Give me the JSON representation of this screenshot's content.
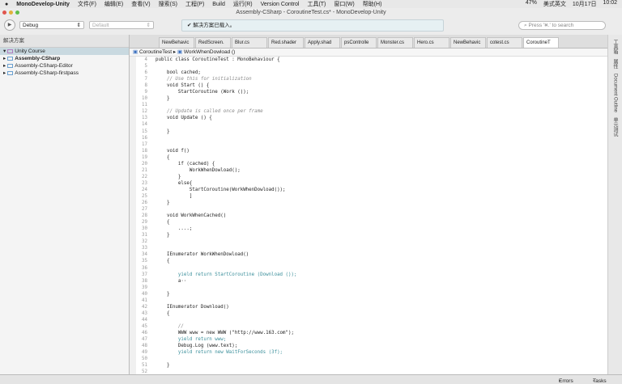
{
  "menubar": {
    "app": "MonoDevelop-Unity",
    "items": [
      "文件(F)",
      "编辑(E)",
      "查看(V)",
      "搜索(S)",
      "工程(P)",
      "Build",
      "运行(R)",
      "Version Control",
      "工具(T)",
      "窗口(W)",
      "帮助(H)"
    ],
    "battery": "47%",
    "input": "美式英文",
    "date": "10月17日",
    "time": "10:02"
  },
  "window": {
    "title": "Assembly-CSharp - CoroutineTest.cs* - MonoDevelop-Unity"
  },
  "toolbar": {
    "config": "Debug",
    "platform": "Default",
    "status": "解决方案已载入。",
    "search_placeholder": "Press '⌘.' to search"
  },
  "sidebar": {
    "title": "解决方案",
    "root": "Unity Course",
    "items": [
      "Assembly-CSharp",
      "Assembly-CSharp-Editor",
      "Assembly-CSharp-firstpass"
    ]
  },
  "tabs": [
    "NewBehavic",
    "RedScreen.",
    "Blur.cs",
    "Red.shader",
    "Apply.shad",
    "psControlle",
    "Monster.cs",
    "Hero.cs",
    "NewBehavic",
    "cotest.cs",
    "CoroutineT"
  ],
  "breadcrumb": {
    "class": "CoroutineTest",
    "method": "WorkWhenDowload ()"
  },
  "code": {
    "start": 4,
    "lines": [
      "public class CoroutineTest : MonoBehaviour {",
      "",
      "    bool cached;",
      "    // Use this for initialization",
      "    void Start () {",
      "        StartCoroutine (Work ());",
      "    }",
      "",
      "    // Update is called once per frame",
      "    void Update () {",
      "",
      "    }",
      "",
      "",
      "    void f()",
      "    {",
      "        if (cached) {",
      "            WorkWhenDowload();",
      "        }",
      "        else{",
      "            StartCoroutine(WorkWhenDowload());",
      "            ]",
      "    }",
      "",
      "    void WorkWhenCached()",
      "    {",
      "        ....;",
      "    }",
      "",
      "",
      "    IEnumerator WorkWhenDowload()",
      "    {",
      "",
      "        yield return StartCoroutine (Download ());",
      "        a··",
      "",
      "    }",
      "",
      "    IEnumerator Download()",
      "    {",
      "",
      "        //",
      "        WWW www = new WWW (\"http://www.163.com\");",
      "        yield return www;",
      "        Debug.Log (www.text);",
      "        yield return new WaitForSeconds (3f);",
      "",
      "    }",
      ""
    ]
  },
  "right_panel": [
    "工具箱",
    "属性",
    "Document Outline",
    "单元测试"
  ],
  "bottom": {
    "errors": "Errors",
    "tasks": "Tasks"
  }
}
